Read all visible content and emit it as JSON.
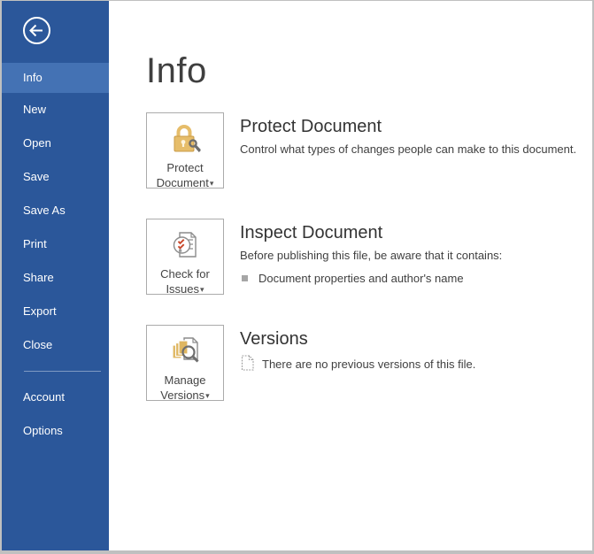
{
  "colors": {
    "sidebar-blue": "#2b579a",
    "sidebar-selected": "#4472b4",
    "window-border": "#c0c0c0",
    "title-text": "#3f3f3f",
    "heading-text": "#333333",
    "body-text": "#404040",
    "button-border": "#ababab",
    "icon-gray": "#8c8c8c",
    "lock-gold": "#e6bd6a",
    "key-gray": "#6e6e6e",
    "check-red": "#c8472a",
    "pages-gold": "#dfb660",
    "bullet-gray": "#a6a6a6"
  },
  "icons": {
    "dropdown": "▾"
  },
  "page": {
    "title": "Info"
  },
  "sidebar": {
    "items": [
      {
        "label": "Info",
        "selected": true
      },
      {
        "label": "New"
      },
      {
        "label": "Open"
      },
      {
        "label": "Save"
      },
      {
        "label": "Save As"
      },
      {
        "label": "Print"
      },
      {
        "label": "Share"
      },
      {
        "label": "Export"
      },
      {
        "label": "Close"
      }
    ],
    "items_bottom": [
      {
        "label": "Account"
      },
      {
        "label": "Options"
      }
    ]
  },
  "sections": [
    {
      "button": {
        "line1": "Protect",
        "line2": "Document"
      },
      "heading": "Protect Document",
      "description": "Control what types of changes people can make to this document."
    },
    {
      "button": {
        "line1": "Check for",
        "line2": "Issues"
      },
      "heading": "Inspect Document",
      "description": "Before publishing this file, be aware that it contains:",
      "bullet": "Document properties and author's name"
    },
    {
      "button": {
        "line1": "Manage",
        "line2": "Versions"
      },
      "heading": "Versions",
      "note": "There are no previous versions of this file."
    }
  ]
}
